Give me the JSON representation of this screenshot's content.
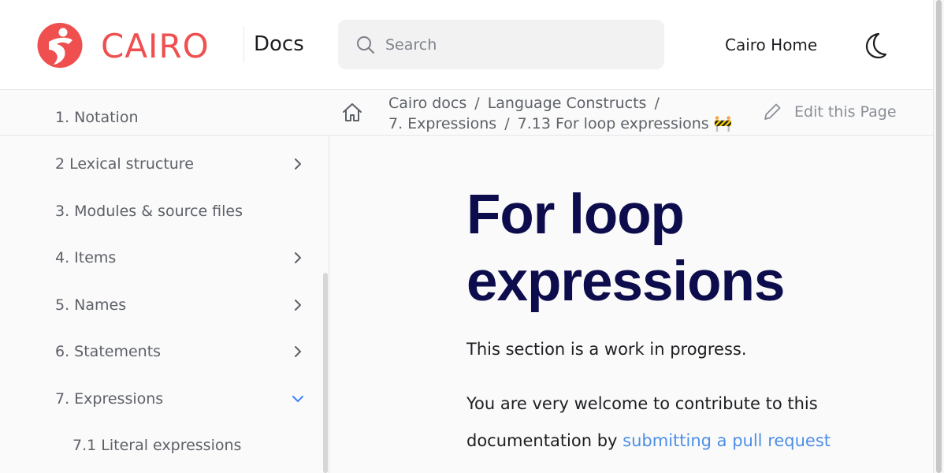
{
  "header": {
    "brand": "CAIRO",
    "docs_label": "Docs",
    "search_placeholder": "Search",
    "home_link": "Cairo Home"
  },
  "sidebar": {
    "items": [
      {
        "label": "1. Notation",
        "expandable": false
      },
      {
        "label": "2 Lexical structure",
        "expandable": true
      },
      {
        "label": "3. Modules & source files",
        "expandable": false
      },
      {
        "label": "4. Items",
        "expandable": true
      },
      {
        "label": "5. Names",
        "expandable": true
      },
      {
        "label": "6. Statements",
        "expandable": true
      },
      {
        "label": "7. Expressions",
        "expandable": true,
        "expanded": true
      },
      {
        "label": "7.1 Literal expressions",
        "expandable": false
      }
    ]
  },
  "breadcrumb": {
    "line1": [
      "Cairo docs",
      "Language Constructs"
    ],
    "line2": [
      "7. Expressions",
      "7.13 For loop expressions 🚧"
    ],
    "edit_label": "Edit this Page"
  },
  "main": {
    "title": "For loop expressions",
    "paragraph1": "This section is a work in progress.",
    "paragraph2_prefix": "You are very welcome to contribute to this documentation by ",
    "paragraph2_link": "submitting a pull request"
  },
  "colors": {
    "brand": "#ef4f4f",
    "title": "#0d0d4d",
    "link": "#4d8fe6",
    "expanded_chevron": "#3b82f6"
  }
}
